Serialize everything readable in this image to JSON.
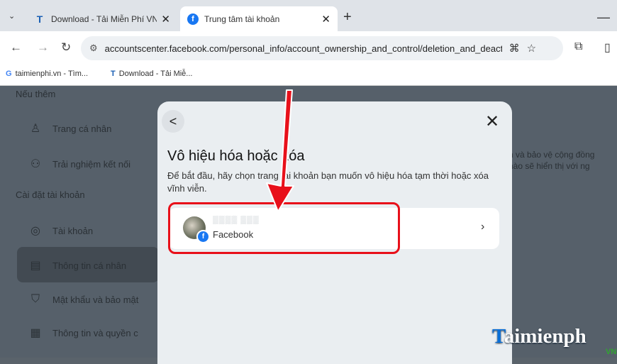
{
  "tabs": [
    {
      "title": "Download - Tải Miễn Phí VN - P",
      "icon": "T"
    },
    {
      "title": "Trung tâm tài khoản",
      "icon": "f"
    }
  ],
  "toolbar": {
    "url": "accountscenter.facebook.com/personal_info/account_ownership_and_control/deletion_and_deactivat..."
  },
  "bookmarks": [
    {
      "label": "taimienphi.vn - Tìm...",
      "icon": "G"
    },
    {
      "label": "Download - Tải Miễ...",
      "icon": "T"
    }
  ],
  "sidebar": {
    "top_link": "Nếu thêm",
    "items_top": [
      "Trang cá nhân",
      "Trải nghiệm kết nối"
    ],
    "section": "Cài đặt tài khoản",
    "items": [
      "Tài khoản",
      "Thông tin cá nhân",
      "Mật khẩu và bảo mật",
      "Thông tin và quyền c"
    ]
  },
  "right_text": [
    "n và bảo vệ cộng đồng",
    "nào sẽ hiển thị với ng"
  ],
  "modal": {
    "back": "<",
    "close": "✕",
    "title": "Vô hiệu hóa hoặc xóa",
    "desc": "Để bắt đầu, hãy chọn trang tài khoản bạn muốn vô hiệu hóa tạm thời hoặc xóa vĩnh viễn.",
    "account": {
      "platform": "Facebook"
    }
  },
  "watermark": {
    "cap": "T",
    "rest": "aimienph",
    "sub": "VN"
  },
  "colors": {
    "highlight": "#e8101a",
    "facebook_blue": "#1877f2"
  }
}
